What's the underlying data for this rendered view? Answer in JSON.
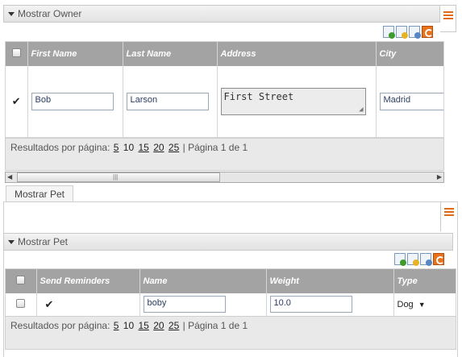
{
  "owner_panel": {
    "title": "Mostrar Owner",
    "columns": [
      "First Name",
      "Last Name",
      "Address",
      "City"
    ],
    "row": {
      "checked": "✔",
      "first_name": "Bob",
      "last_name": "Larson",
      "address": "First Street",
      "city": "Madrid"
    },
    "paginator": {
      "label": "Resultados por página:",
      "options": [
        "5",
        "10",
        "15",
        "20",
        "25"
      ],
      "sep": "|",
      "page_info": "Página 1 de 1"
    },
    "toolbar_icons": [
      "add-record-icon",
      "edit-record-icon",
      "delete-record-icon",
      "refresh-icon"
    ]
  },
  "tab": {
    "label": "Mostrar Pet"
  },
  "pet_panel": {
    "title": "Mostrar Pet",
    "columns": [
      "Send Reminders",
      "Name",
      "Weight",
      "Type"
    ],
    "row": {
      "send_reminders": "✔",
      "name": "boby",
      "weight": "10.0",
      "type": "Dog"
    },
    "paginator": {
      "label": "Resultados por página:",
      "options": [
        "5",
        "10",
        "15",
        "20",
        "25"
      ],
      "sep": "|",
      "page_info": "Página 1 de 1"
    },
    "toolbar_icons": [
      "add-record-icon",
      "edit-record-icon",
      "delete-record-icon",
      "refresh-icon"
    ]
  },
  "colors": {
    "accent": "#e06c1a",
    "header_bg": "#a3a3a3",
    "link": "#2b3d63"
  }
}
